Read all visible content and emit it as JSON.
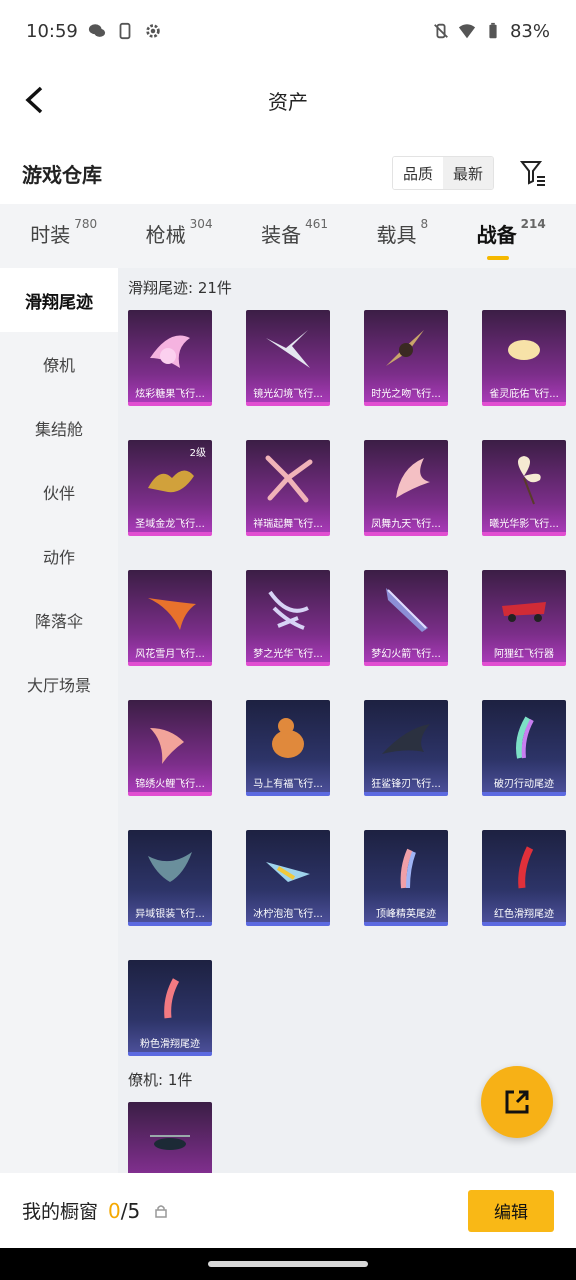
{
  "status_bar": {
    "time": "10:59",
    "battery": "83%"
  },
  "nav": {
    "title": "资产"
  },
  "warehouse": {
    "title": "游戏仓库",
    "sort_quality": "品质",
    "sort_newest": "最新"
  },
  "tabs": [
    {
      "label": "时装",
      "count": "780"
    },
    {
      "label": "枪械",
      "count": "304"
    },
    {
      "label": "装备",
      "count": "461"
    },
    {
      "label": "载具",
      "count": "8"
    },
    {
      "label": "战备",
      "count": "214"
    }
  ],
  "sidebar": {
    "items": [
      "滑翔尾迹",
      "僚机",
      "集结舱",
      "伙伴",
      "动作",
      "降落伞",
      "大厅场景"
    ]
  },
  "sections": {
    "glide": {
      "label": "滑翔尾迹: 21件",
      "items": [
        "炫彩糖果飞行...",
        "镜光幻境飞行...",
        "时光之吻飞行...",
        "雀灵庇佑飞行...",
        "圣域金龙飞行...",
        "祥瑞起舞飞行...",
        "凤舞九天飞行...",
        "曦光华影飞行...",
        "风花雪月飞行...",
        "梦之光华飞行...",
        "梦幻火箭飞行...",
        "阿狸红飞行器",
        "锦绣火鲤飞行...",
        "马上有福飞行...",
        "狂鲨锋刃飞行...",
        "破刃行动尾迹",
        "异域银装飞行...",
        "冰柠泡泡飞行...",
        "顶峰精英尾迹",
        "红色滑翔尾迹",
        "粉色滑翔尾迹"
      ],
      "level_badge": "2级"
    },
    "wingman": {
      "label": "僚机: 1件"
    }
  },
  "bottom": {
    "showcase_label": "我的橱窗",
    "count_now": "0",
    "count_total": "/5",
    "edit_label": "编辑"
  },
  "colors": {
    "accent": "#f7b116",
    "purple_card": "#7c2e8a",
    "blue_card": "#2d3468"
  }
}
